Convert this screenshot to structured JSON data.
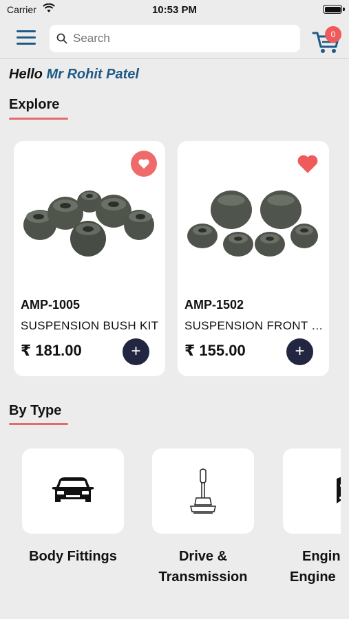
{
  "status_bar": {
    "carrier": "Carrier",
    "time": "10:53 PM"
  },
  "header": {
    "search_placeholder": "Search",
    "cart_count": "0"
  },
  "greeting": {
    "prefix": "Hello",
    "name": "Mr Rohit Patel"
  },
  "explore": {
    "title": "Explore",
    "products": [
      {
        "code": "AMP-1005",
        "name": "SUSPENSION BUSH KIT",
        "price": "₹ 181.00",
        "favorite_style": "filled-circle"
      },
      {
        "code": "AMP-1502",
        "name": "SUSPENSION FRONT BUSH",
        "price": "₹ 155.00",
        "favorite_style": "plain"
      }
    ]
  },
  "by_type": {
    "title": "By Type",
    "types": [
      {
        "label_line1": "Body Fittings",
        "label_line2": "",
        "icon": "car-icon"
      },
      {
        "label_line1": "Drive &",
        "label_line2": "Transmission",
        "icon": "gear-shift-icon"
      },
      {
        "label_line1": "Engine",
        "label_line2": "Engine",
        "icon": "engine-icon"
      }
    ]
  },
  "colors": {
    "accent": "#1e5a85",
    "badge": "#ef5a5a",
    "add_button": "#222640",
    "underline": "#e36b6b"
  }
}
